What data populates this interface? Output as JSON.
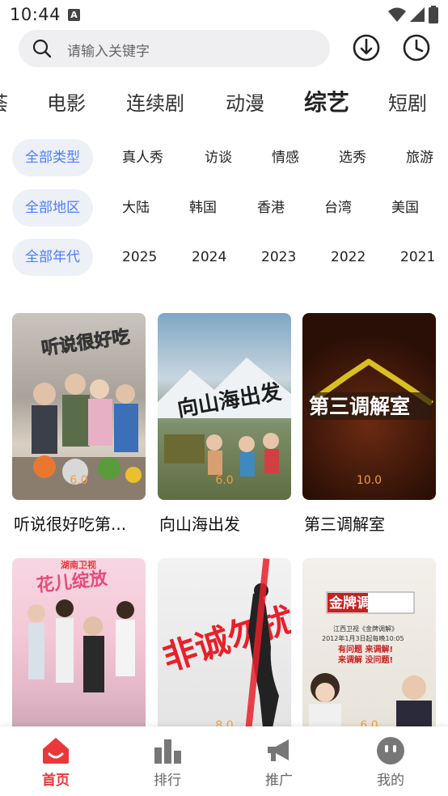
{
  "status_bar": {
    "time": "10:44",
    "notification_badge": "A"
  },
  "search": {
    "placeholder": "请输入关键字"
  },
  "category_tabs": [
    {
      "label": "荟",
      "active": false
    },
    {
      "label": "电影",
      "active": false
    },
    {
      "label": "连续剧",
      "active": false
    },
    {
      "label": "动漫",
      "active": false
    },
    {
      "label": "综艺",
      "active": true
    },
    {
      "label": "短剧",
      "active": false
    }
  ],
  "filters": {
    "type": [
      "全部类型",
      "真人秀",
      "访谈",
      "情感",
      "选秀",
      "旅游"
    ],
    "region": [
      "全部地区",
      "大陆",
      "韩国",
      "香港",
      "台湾",
      "美国"
    ],
    "year": [
      "全部年代",
      "2025",
      "2024",
      "2023",
      "2022",
      "2021"
    ]
  },
  "cards": [
    {
      "title": "听说很好吃第...",
      "score": "6.0",
      "poster_text": "听说很好吃"
    },
    {
      "title": "向山海出发",
      "score": "6.0",
      "poster_text": "向山海出发"
    },
    {
      "title": "第三调解室",
      "score": "10.0",
      "poster_text": "第三调解室"
    },
    {
      "title": "",
      "score": "",
      "poster_text": "花儿绽放"
    },
    {
      "title": "",
      "score": "8.0",
      "poster_text": "非诚勿扰"
    },
    {
      "title": "",
      "score": "6.0",
      "poster_text": "金牌调解"
    }
  ],
  "poster_extra": {
    "jinpai_line1": "江西卫视《金牌调解》",
    "jinpai_line2": "2012年1月3日起每晚10:05",
    "jinpai_line3": "有问题 来调解!",
    "jinpai_line4": "来调解 没问题!"
  },
  "bottom_nav": [
    {
      "label": "首页",
      "icon": "home-icon",
      "active": true
    },
    {
      "label": "排行",
      "icon": "bar-chart-icon",
      "active": false
    },
    {
      "label": "推广",
      "icon": "megaphone-icon",
      "active": false
    },
    {
      "label": "我的",
      "icon": "face-icon",
      "active": false
    }
  ],
  "colors": {
    "accent": "#e8383a",
    "chip_active": "#4a7dff",
    "score": "#f0a040"
  }
}
